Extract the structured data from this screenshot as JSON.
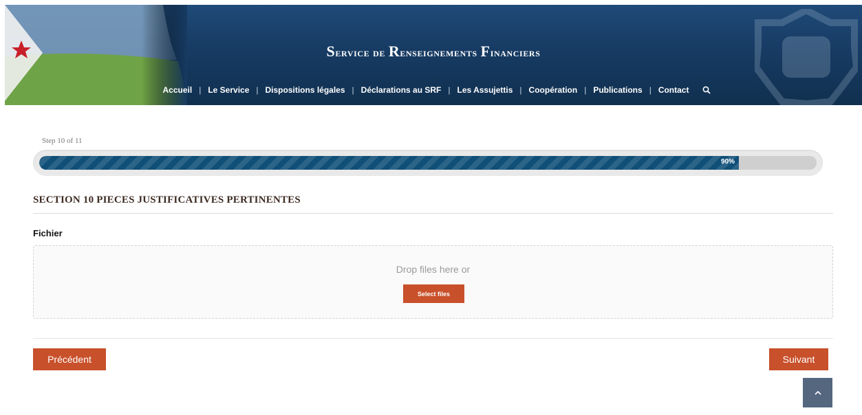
{
  "header": {
    "title_parts": [
      {
        "initial": "S",
        "rest": "ervice de "
      },
      {
        "initial": "R",
        "rest": "enseignements "
      },
      {
        "initial": "F",
        "rest": "inanciers"
      }
    ],
    "nav": [
      "Accueil",
      "Le Service",
      "Dispositions légales",
      "Déclarations au SRF",
      "Les Assujettis",
      "Coopération",
      "Publications",
      "Contact"
    ],
    "search_icon": "search-icon"
  },
  "progress": {
    "step_text": "Step 10 of 11",
    "percent": 90,
    "percent_label": "90%",
    "fill_color": "#0f4f78"
  },
  "section": {
    "title": "SECTION 10 PIECES JUSTIFICATIVES PERTINENTES",
    "field_label": "Fichier",
    "drop_text": "Drop files here or",
    "select_label": "Select files"
  },
  "buttons": {
    "prev": "Précédent",
    "next": "Suivant",
    "accent": "#c8502a"
  },
  "back_to_top_icon": "chevron-up-icon"
}
